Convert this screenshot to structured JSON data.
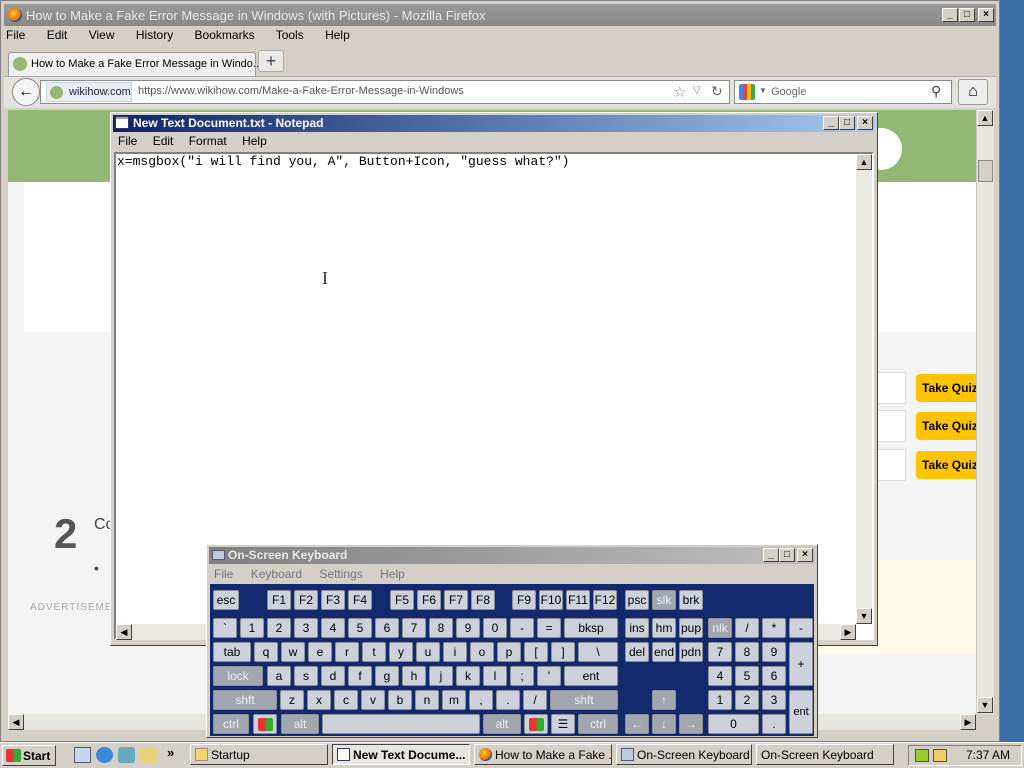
{
  "firefox": {
    "window_title": "How to Make a Fake Error Message in Windows (with Pictures) - Mozilla Firefox",
    "menu": [
      "File",
      "Edit",
      "View",
      "History",
      "Bookmarks",
      "Tools",
      "Help"
    ],
    "tab_title": "How to Make a Fake Error Message in Windo...",
    "new_tab_label": "+",
    "site_badge": "wikihow.com",
    "url": "https://www.wikihow.com/Make-a-Fake-Error-Message-in-Windows",
    "search_placeholder": "Google",
    "page": {
      "step_number": "2",
      "step_text": "Co",
      "bullet": "•",
      "advertisement_label": "ADVERTISEMENT",
      "quiz_buttons": [
        "Take Quiz",
        "Take Quiz",
        "Take Quiz"
      ],
      "brand_color": "#93b874",
      "quiz_color": "#ffc300"
    }
  },
  "notepad": {
    "title": "New Text Document.txt - Notepad",
    "menu": [
      "File",
      "Edit",
      "Format",
      "Help"
    ],
    "content": "x=msgbox(\"i will find you, A\", Button+Icon, \"guess what?\")"
  },
  "osk": {
    "title": "On-Screen Keyboard",
    "menu": [
      "File",
      "Keyboard",
      "Settings",
      "Help"
    ],
    "rows": [
      [
        "esc",
        "F1",
        "F2",
        "F3",
        "F4",
        "F5",
        "F6",
        "F7",
        "F8",
        "F9",
        "F10",
        "F11",
        "F12",
        "psc",
        "slk",
        "brk"
      ],
      [
        "`",
        "1",
        "2",
        "3",
        "4",
        "5",
        "6",
        "7",
        "8",
        "9",
        "0",
        "-",
        "=",
        "bksp",
        "ins",
        "hm",
        "pup",
        "nlk",
        "/",
        "*",
        "-"
      ],
      [
        "tab",
        "q",
        "w",
        "e",
        "r",
        "t",
        "y",
        "u",
        "i",
        "o",
        "p",
        "[",
        "]",
        "\\",
        "del",
        "end",
        "pdn",
        "7",
        "8",
        "9",
        "+"
      ],
      [
        "lock",
        "a",
        "s",
        "d",
        "f",
        "g",
        "h",
        "j",
        "k",
        "l",
        ";",
        "'",
        "ent",
        "4",
        "5",
        "6"
      ],
      [
        "shft",
        "z",
        "x",
        "c",
        "v",
        "b",
        "n",
        "m",
        ",",
        ".",
        "/",
        "shft",
        "↑",
        "1",
        "2",
        "3",
        "ent"
      ],
      [
        "ctrl",
        "alt",
        "alt",
        "ctrl",
        "←",
        "↓",
        "→",
        "0",
        "."
      ]
    ]
  },
  "taskbar": {
    "start_label": "Start",
    "quicklaunch_more": "»",
    "buttons": [
      "Startup",
      "New Text Docume...",
      "How to Make a Fake ...",
      "On-Screen Keyboard",
      "On-Screen Keyboard"
    ],
    "clock": "7:37 AM"
  }
}
